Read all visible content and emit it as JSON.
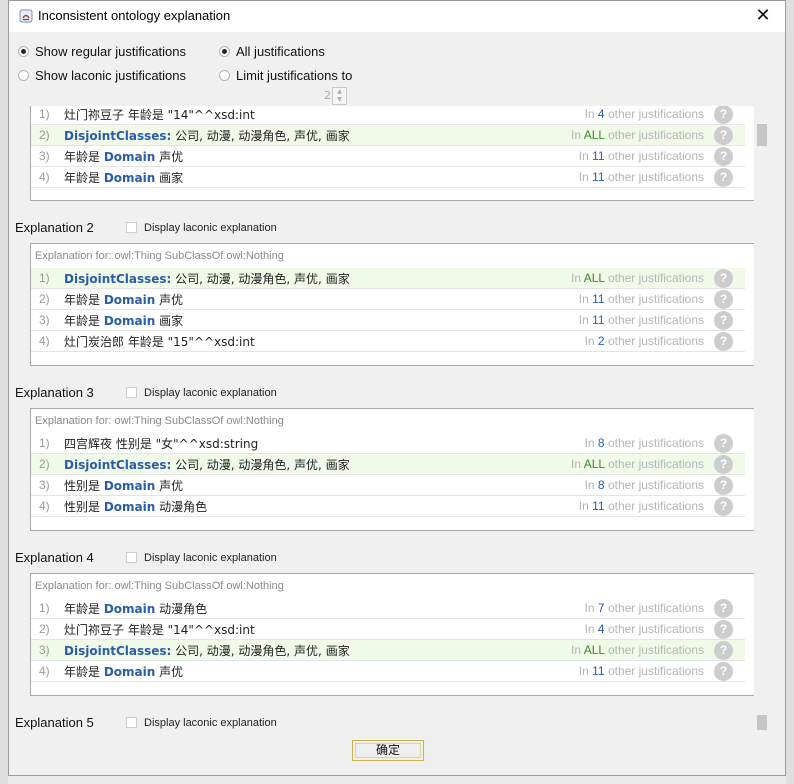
{
  "window": {
    "title": "Inconsistent ontology explanation",
    "close_glyph": "✕"
  },
  "options": {
    "show_regular": "Show regular justifications",
    "show_laconic": "Show laconic justifications",
    "all_justifications": "All justifications",
    "limit_justifications": "Limit justifications to",
    "limit_value": "2"
  },
  "partial_explanation": {
    "rows": [
      {
        "num": "1)",
        "axiom": "灶门祢豆子 年龄是 \"14\"^^xsd:int",
        "keyword": "",
        "pre": "灶门祢豆子 年龄是 \"14\"^^xsd:int",
        "post": "",
        "in": "In",
        "count": "4",
        "rest": "other justifications",
        "highlight": false
      },
      {
        "num": "2)",
        "pre": "",
        "keyword": "DisjointClasses:",
        "post": " 公司, 动漫, 动漫角色, 声优, 画家",
        "in": "In",
        "count": "ALL",
        "rest": "other justifications",
        "highlight": true
      },
      {
        "num": "3)",
        "pre": "年龄是 ",
        "keyword": "Domain",
        "post": " 声优",
        "in": "In",
        "count": "11",
        "rest": "other justifications",
        "highlight": false
      },
      {
        "num": "4)",
        "pre": "年龄是 ",
        "keyword": "Domain",
        "post": " 画家",
        "in": "In",
        "count": "11",
        "rest": "other justifications",
        "highlight": false
      }
    ]
  },
  "explanations": [
    {
      "title": "Explanation 2",
      "laconic_label": "Display laconic explanation",
      "caption": "Explanation for: owl:Thing SubClassOf owl:Nothing",
      "rows": [
        {
          "num": "1)",
          "pre": "",
          "keyword": "DisjointClasses:",
          "post": " 公司, 动漫, 动漫角色, 声优, 画家",
          "in": "In",
          "count": "ALL",
          "rest": "other justifications",
          "highlight": true
        },
        {
          "num": "2)",
          "pre": "年龄是 ",
          "keyword": "Domain",
          "post": " 声优",
          "in": "In",
          "count": "11",
          "rest": "other justifications",
          "highlight": false
        },
        {
          "num": "3)",
          "pre": "年龄是 ",
          "keyword": "Domain",
          "post": " 画家",
          "in": "In",
          "count": "11",
          "rest": "other justifications",
          "highlight": false
        },
        {
          "num": "4)",
          "pre": "灶门炭治郎 年龄是 \"15\"^^xsd:int",
          "keyword": "",
          "post": "",
          "in": "In",
          "count": "2",
          "rest": "other justifications",
          "highlight": false
        }
      ]
    },
    {
      "title": "Explanation 3",
      "laconic_label": "Display laconic explanation",
      "caption": "Explanation for: owl:Thing SubClassOf owl:Nothing",
      "rows": [
        {
          "num": "1)",
          "pre": "四宫辉夜 性别是 \"女\"^^xsd:string",
          "keyword": "",
          "post": "",
          "in": "In",
          "count": "8",
          "rest": "other justifications",
          "highlight": false
        },
        {
          "num": "2)",
          "pre": "",
          "keyword": "DisjointClasses:",
          "post": " 公司, 动漫, 动漫角色, 声优, 画家",
          "in": "In",
          "count": "ALL",
          "rest": "other justifications",
          "highlight": true
        },
        {
          "num": "3)",
          "pre": "性别是 ",
          "keyword": "Domain",
          "post": " 声优",
          "in": "In",
          "count": "8",
          "rest": "other justifications",
          "highlight": false
        },
        {
          "num": "4)",
          "pre": "性别是 ",
          "keyword": "Domain",
          "post": " 动漫角色",
          "in": "In",
          "count": "11",
          "rest": "other justifications",
          "highlight": false
        }
      ]
    },
    {
      "title": "Explanation 4",
      "laconic_label": "Display laconic explanation",
      "caption": "Explanation for: owl:Thing SubClassOf owl:Nothing",
      "rows": [
        {
          "num": "1)",
          "pre": "年龄是 ",
          "keyword": "Domain",
          "post": " 动漫角色",
          "in": "In",
          "count": "7",
          "rest": "other justifications",
          "highlight": false
        },
        {
          "num": "2)",
          "pre": "灶门祢豆子 年龄是 \"14\"^^xsd:int",
          "keyword": "",
          "post": "",
          "in": "In",
          "count": "4",
          "rest": "other justifications",
          "highlight": false
        },
        {
          "num": "3)",
          "pre": "",
          "keyword": "DisjointClasses:",
          "post": " 公司, 动漫, 动漫角色, 声优, 画家",
          "in": "In",
          "count": "ALL",
          "rest": "other justifications",
          "highlight": true
        },
        {
          "num": "4)",
          "pre": "年龄是 ",
          "keyword": "Domain",
          "post": " 声优",
          "in": "In",
          "count": "11",
          "rest": "other justifications",
          "highlight": false
        }
      ]
    }
  ],
  "explanation5": {
    "title": "Explanation 5",
    "laconic_label": "Display laconic explanation"
  },
  "help_glyph": "?",
  "ok_label": "确定",
  "colors": {
    "highlight": "#f1f9e9",
    "keyword": "#2a5da8",
    "all": "#3b8a2a"
  }
}
